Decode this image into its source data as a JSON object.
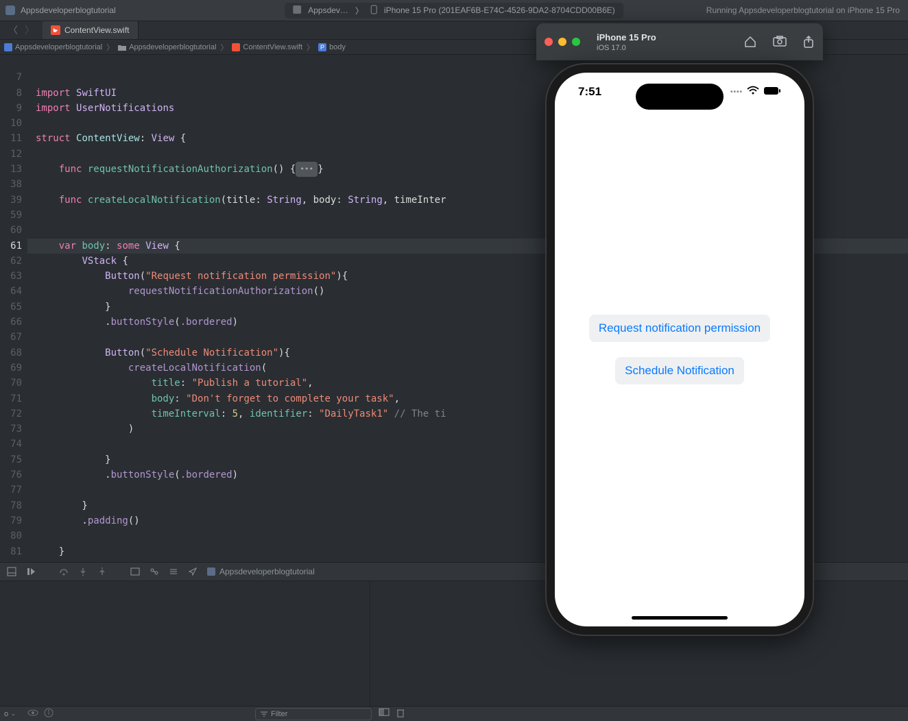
{
  "toolbar": {
    "scheme_name": "Appsdeveloperblogtutorial",
    "run_target_app": "Appsdev…",
    "run_target_device": "iPhone 15 Pro (201EAF6B-E74C-4526-9DA2-8704CDD00B6E)",
    "status_text": "Running Appsdeveloperblogtutorial on iPhone 15 Pro"
  },
  "tab": {
    "filename": "ContentView.swift"
  },
  "breadcrumb": {
    "items": [
      "Appsdeveloperblogtutorial",
      "Appsdeveloperblogtutorial",
      "ContentView.swift",
      "body"
    ]
  },
  "editor": {
    "line_numbers": [
      "",
      "7",
      "8",
      "9",
      "10",
      "11",
      "12",
      "13",
      "38",
      "39",
      "59",
      "60",
      "61",
      "62",
      "63",
      "64",
      "65",
      "66",
      "67",
      "68",
      "69",
      "70",
      "71",
      "72",
      "73",
      "74",
      "75",
      "76",
      "77",
      "78",
      "79",
      "80",
      "81",
      ""
    ],
    "highlighted_line_index": 12
  },
  "code": {
    "import1_kw": "import",
    "import1_mod": "SwiftUI",
    "import2_kw": "import",
    "import2_mod": "UserNotifications",
    "struct_kw": "struct",
    "struct_name": "ContentView",
    "protocol": "View",
    "func_kw": "func",
    "fn_request": "requestNotificationAuthorization",
    "fn_create": "createLocalNotification",
    "create_params_prefix": "(title: ",
    "type_string": "String",
    "body_label": ", body: ",
    "time_label": ", timeInter",
    "var_kw": "var",
    "var_name": "body",
    "some_kw": "some",
    "view_type": "View",
    "vstack": "VStack",
    "button": "Button",
    "btn1_str": "\"Request notification permission\"",
    "call_request": "requestNotificationAuthorization",
    "buttonStyle": "buttonStyle",
    "bordered": ".bordered",
    "btn2_str": "\"Schedule Notification\"",
    "call_create": "createLocalNotification",
    "p_title": "title",
    "p_title_val": "\"Publish a tutorial\"",
    "p_body": "body",
    "p_body_val": "\"Don't forget to complete your task\"",
    "p_time": "timeInterval",
    "p_time_val": "5",
    "p_id": "identifier",
    "p_id_val": "\"DailyTask1\"",
    "comment_tail": "// The ti",
    "padding_call": "padding",
    "fold_ellipsis": "•••"
  },
  "debugbar": {
    "target": "Appsdeveloperblogtutorial"
  },
  "footer": {
    "auto_label": "o",
    "filter_placeholder": "Filter"
  },
  "simulator": {
    "device": "iPhone 15 Pro",
    "os": "iOS 17.0",
    "time": "7:51",
    "button1": "Request notification permission",
    "button2": "Schedule Notification"
  }
}
